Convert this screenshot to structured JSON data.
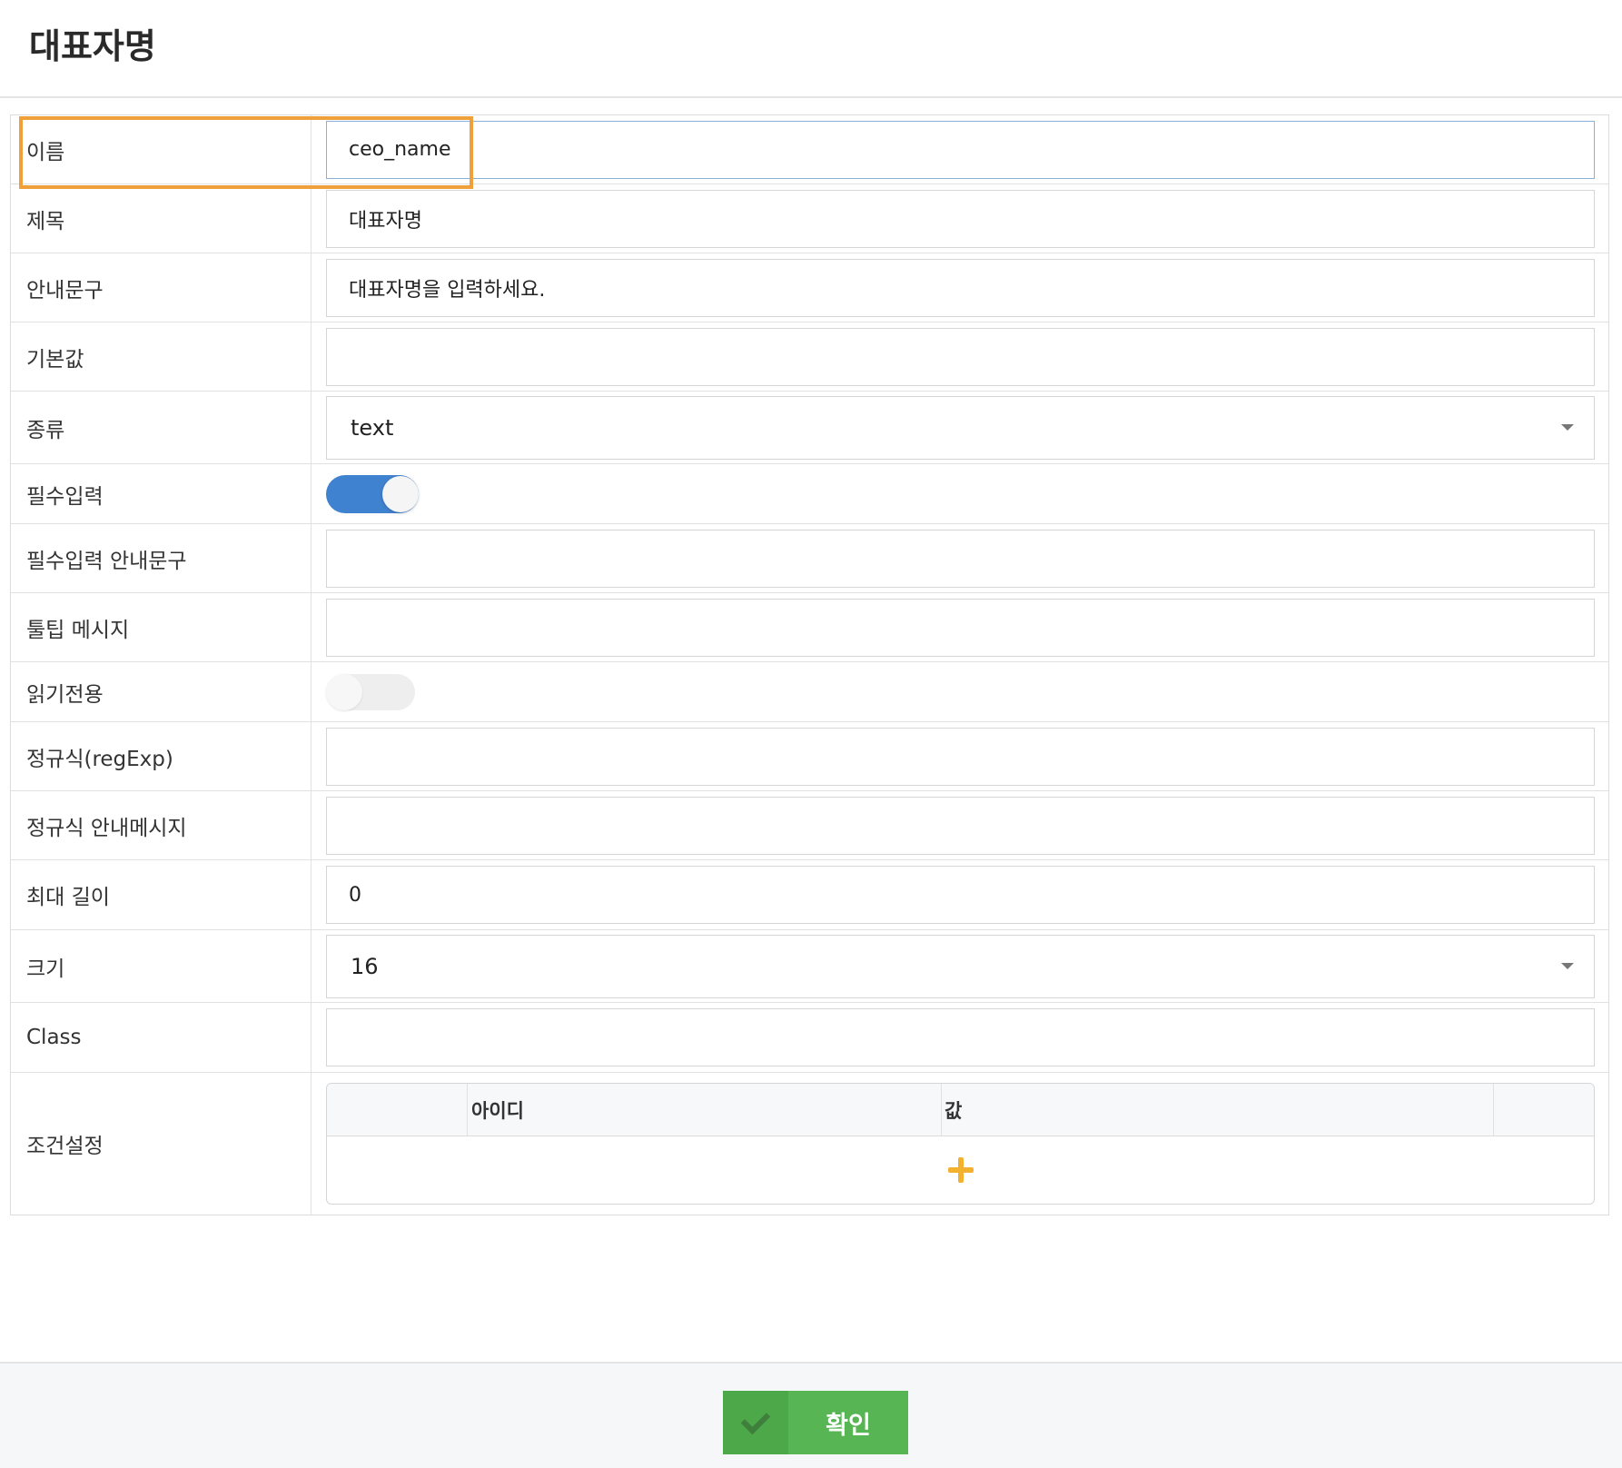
{
  "page": {
    "title": "대표자명"
  },
  "fields": {
    "name": {
      "label": "이름",
      "value": "ceo_name"
    },
    "subject": {
      "label": "제목",
      "value": "대표자명"
    },
    "guide_text": {
      "label": "안내문구",
      "value": "대표자명을 입력하세요."
    },
    "default_value": {
      "label": "기본값",
      "value": ""
    },
    "type": {
      "label": "종류",
      "value": "text"
    },
    "required": {
      "label": "필수입력",
      "state": "on"
    },
    "required_guide": {
      "label": "필수입력 안내문구",
      "value": ""
    },
    "tooltip": {
      "label": "툴팁 메시지",
      "value": ""
    },
    "readonly": {
      "label": "읽기전용",
      "state": "off"
    },
    "regexp": {
      "label": "정규식(regExp)",
      "value": ""
    },
    "regexp_guide": {
      "label": "정규식 안내메시지",
      "value": ""
    },
    "max_length": {
      "label": "최대 길이",
      "value": "0"
    },
    "size": {
      "label": "크기",
      "value": "16"
    },
    "class": {
      "label": "Class",
      "value": ""
    },
    "conditions": {
      "label": "조건설정",
      "columns": [
        "",
        "아이디",
        "값",
        ""
      ]
    }
  },
  "footer": {
    "confirm_label": "확인"
  },
  "colors": {
    "accent_blue": "#3f82cf",
    "highlight_orange": "#f0a03a",
    "confirm_green": "#57b653",
    "plus_yellow": "#f2b230"
  },
  "icons": {
    "select_caret": "chevron-down-icon",
    "add": "plus-icon",
    "confirm": "check-icon"
  }
}
